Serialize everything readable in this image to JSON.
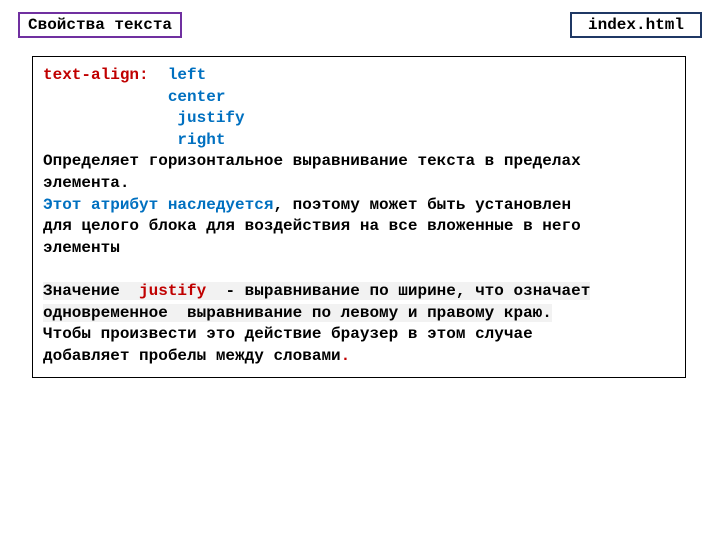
{
  "header": {
    "title": "Свойства текста",
    "filename": "index.html"
  },
  "css": {
    "property": "text-align:",
    "values": {
      "v1": "left",
      "v2": "center",
      "v3": "justify",
      "v4": "right"
    }
  },
  "body": {
    "desc1a": "Определяет горизонтальное выравнивание текста в пределах",
    "desc1b": "элемента.",
    "inherited": "Этот атрибут наследуется",
    "desc2a": ", поэтому может быть установлен",
    "desc2b": "для целого блока для воздействия на все вложенные в него",
    "desc2c": "элементы",
    "line3a": "Значение  ",
    "justify_word": "justify",
    "line3b": "  - выравнивание по ширине, что означает",
    "line3c": "одновременное  выравнивание по левому и правому краю.",
    "line3d": "Чтобы произвести это действие браузер в этом случае",
    "line3e": "добавляет пробелы между словами",
    "dot": "."
  }
}
